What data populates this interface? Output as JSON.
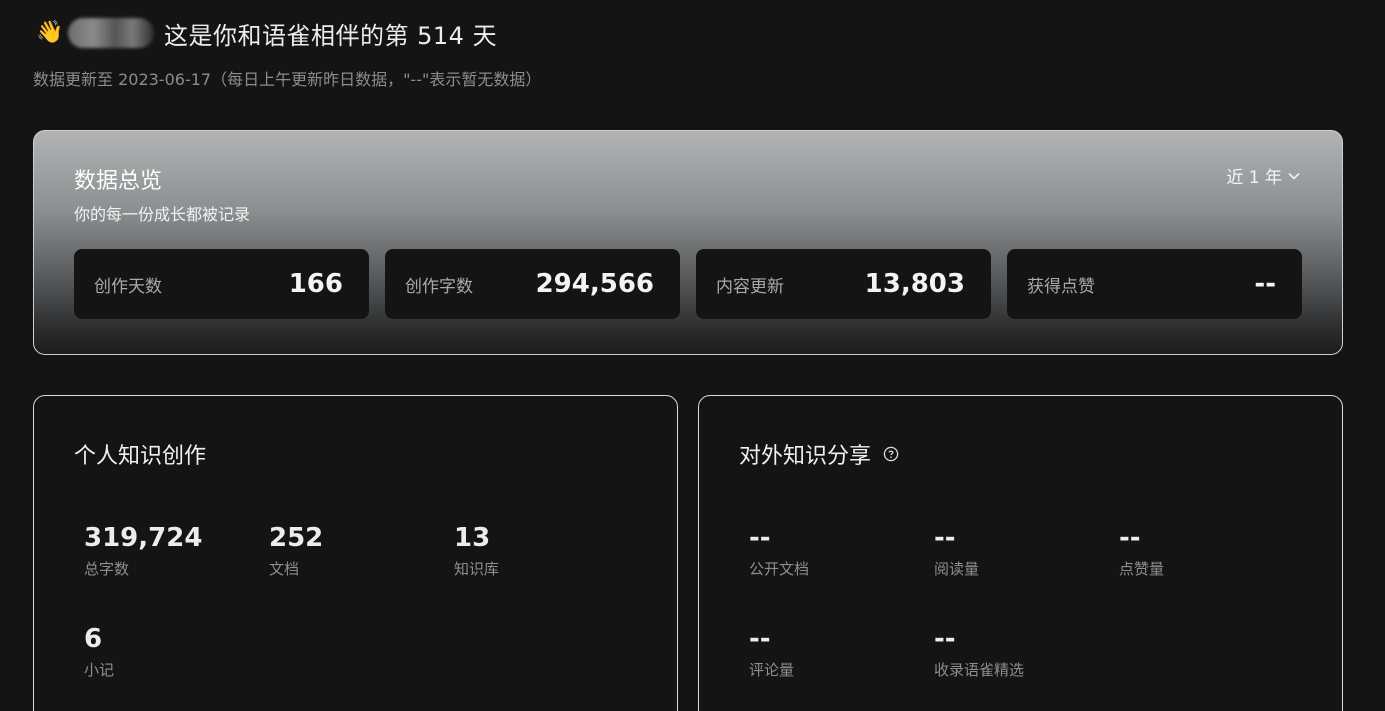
{
  "header": {
    "wave_emoji": "👋",
    "greeting": "这是你和语雀相伴的第 514 天",
    "subtitle": "数据更新至 2023-06-17（每日上午更新昨日数据，\"--\"表示暂无数据）"
  },
  "overview": {
    "title": "数据总览",
    "subtitle": "你的每一份成长都被记录",
    "range_label": "近 1 年",
    "stats": [
      {
        "label": "创作天数",
        "value": "166"
      },
      {
        "label": "创作字数",
        "value": "294,566"
      },
      {
        "label": "内容更新",
        "value": "13,803"
      },
      {
        "label": "获得点赞",
        "value": "--"
      }
    ]
  },
  "personal": {
    "title": "个人知识创作",
    "metrics": [
      {
        "value": "319,724",
        "label": "总字数"
      },
      {
        "value": "252",
        "label": "文档"
      },
      {
        "value": "13",
        "label": "知识库"
      },
      {
        "value": "6",
        "label": "小记"
      }
    ]
  },
  "sharing": {
    "title": "对外知识分享",
    "metrics": [
      {
        "value": "--",
        "label": "公开文档"
      },
      {
        "value": "--",
        "label": "阅读量"
      },
      {
        "value": "--",
        "label": "点赞量"
      },
      {
        "value": "--",
        "label": "评论量"
      },
      {
        "value": "--",
        "label": "收录语雀精选"
      }
    ]
  }
}
